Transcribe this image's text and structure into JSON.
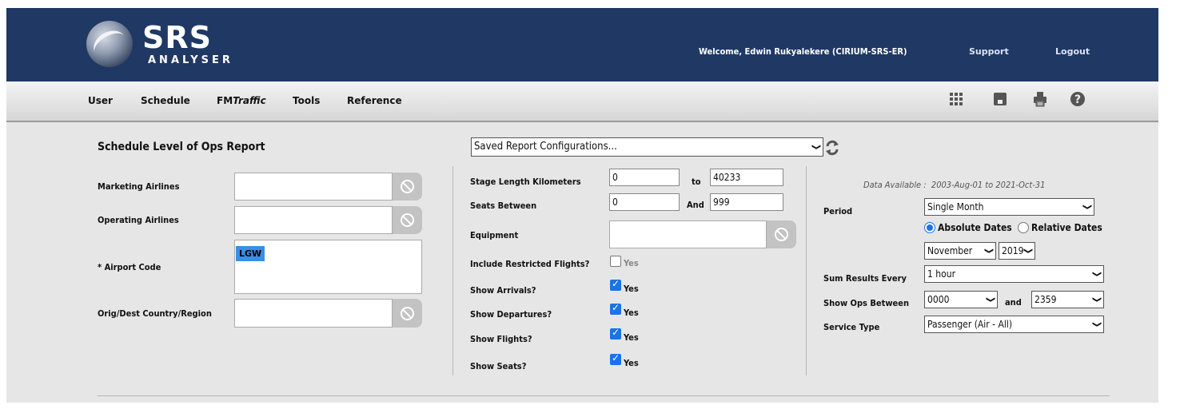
{
  "header": {
    "logo_title": "SRS",
    "logo_subtitle": "ANALYSER",
    "welcome": "Welcome, Edwin Rukyalekere (CIRIUM-SRS-ER)",
    "support": "Support",
    "logout": "Logout"
  },
  "menu": {
    "user": "User",
    "schedule": "Schedule",
    "fm_prefix": "FM",
    "fm_suffix": "Traffic",
    "tools": "Tools",
    "reference": "Reference"
  },
  "toolbar_icons": [
    "grid-icon",
    "save-icon",
    "print-icon",
    "help-icon"
  ],
  "report": {
    "title": "Schedule Level of Ops Report",
    "saved_configs": "Saved Report Configurations..."
  },
  "left": {
    "marketing_airlines": "Marketing Airlines",
    "operating_airlines": "Operating Airlines",
    "airport_code": "* Airport Code",
    "airport_code_tag": "LGW",
    "orig_dest": "Orig/Dest Country/Region"
  },
  "middle": {
    "stage_length": "Stage Length Kilometers",
    "stage_from": "0",
    "stage_to_label": "to",
    "stage_to": "40233",
    "seats_between": "Seats Between",
    "seats_from": "0",
    "seats_and_label": "And",
    "seats_to": "999",
    "equipment": "Equipment",
    "include_restricted": "Include Restricted Flights?",
    "show_arrivals": "Show Arrivals?",
    "show_departures": "Show Departures?",
    "show_flights": "Show Flights?",
    "show_seats": "Show Seats?",
    "yes": "Yes"
  },
  "right": {
    "data_available": "Data Available :  2003-Aug-01 to 2021-Oct-31",
    "period_label": "Period",
    "period_value": "Single Month",
    "absolute_dates": "Absolute Dates",
    "relative_dates": "Relative Dates",
    "month": "November",
    "year": "2019",
    "sum_results_label": "Sum Results Every",
    "sum_results_value": "1 hour",
    "show_ops_label": "Show Ops Between",
    "ops_from": "0000",
    "ops_and": "and",
    "ops_to": "2359",
    "service_type_label": "Service Type",
    "service_type_value": "Passenger (Air - All)"
  },
  "colors": {
    "header_bg": "#1f3864",
    "checkbox_blue": "#1a73e8",
    "tag_blue": "#3a8ee6"
  }
}
